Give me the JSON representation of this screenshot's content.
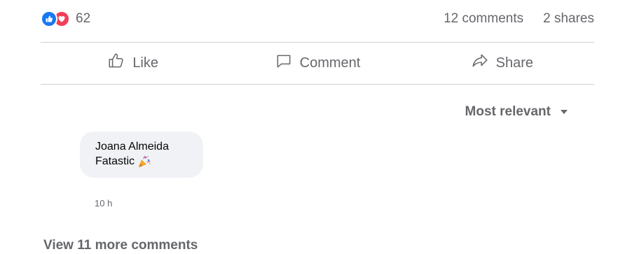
{
  "post_stats": {
    "reaction_count": "62",
    "comments": "12 comments",
    "shares": "2 shares",
    "colors": {
      "like": "#1877f2",
      "love": "#f33e58"
    }
  },
  "actions": [
    {
      "label": "Like",
      "icon": "thumbs-up-icon"
    },
    {
      "label": "Comment",
      "icon": "comment-icon"
    },
    {
      "label": "Share",
      "icon": "share-arrow-icon"
    }
  ],
  "sort": {
    "label": "Most relevant",
    "icon": "caret-down-icon"
  },
  "comments": [
    {
      "author": "Joana Almeida",
      "text": "Fatastic",
      "emoji_icon": "party-popper-icon",
      "time": "10 h"
    }
  ],
  "view_more": "View 11 more comments"
}
